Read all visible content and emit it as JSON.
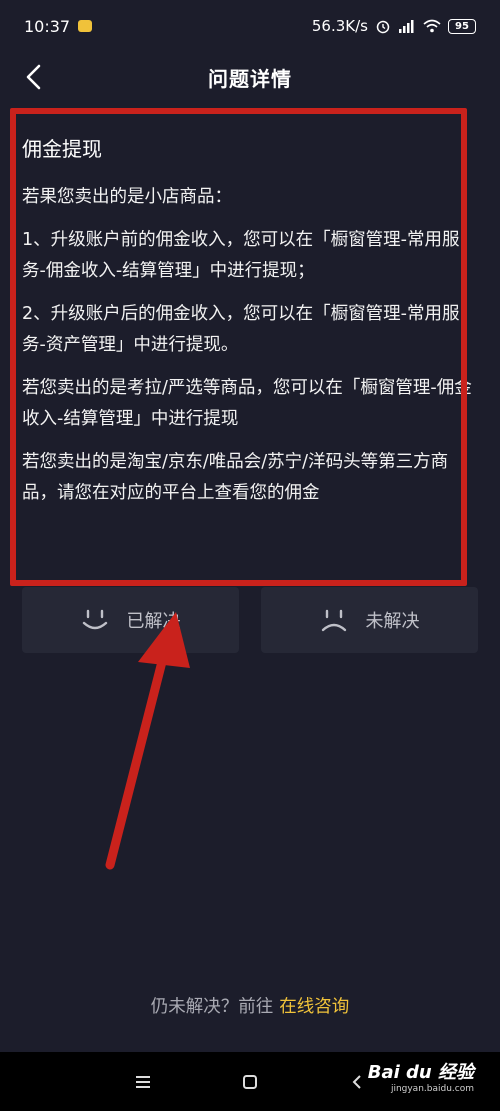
{
  "status_bar": {
    "time": "10:37",
    "net_speed": "56.3K/s",
    "battery": "95"
  },
  "header": {
    "title": "问题详情"
  },
  "article": {
    "title": "佣金提现",
    "paragraphs": [
      "若果您卖出的是小店商品：",
      "1、升级账户前的佣金收入，您可以在「橱窗管理-常用服务-佣金收入-结算管理」中进行提现；",
      "2、升级账户后的佣金收入，您可以在「橱窗管理-常用服务-资产管理」中进行提现。",
      "若您卖出的是考拉/严选等商品，您可以在「橱窗管理-佣金收入-结算管理」中进行提现",
      "若您卖出的是淘宝/京东/唯品会/苏宁/洋码头等第三方商品，请您在对应的平台上查看您的佣金"
    ]
  },
  "feedback": {
    "resolved_label": "已解决",
    "unresolved_label": "未解决"
  },
  "consult": {
    "prompt": "仍未解决？前往",
    "link_label": "在线咨询"
  },
  "watermark": {
    "brand": "Bai du 经验",
    "url": "jingyan.baidu.com"
  },
  "colors": {
    "background": "#1c1d2b",
    "accent": "#f0c23a",
    "highlight": "#c9221c"
  }
}
